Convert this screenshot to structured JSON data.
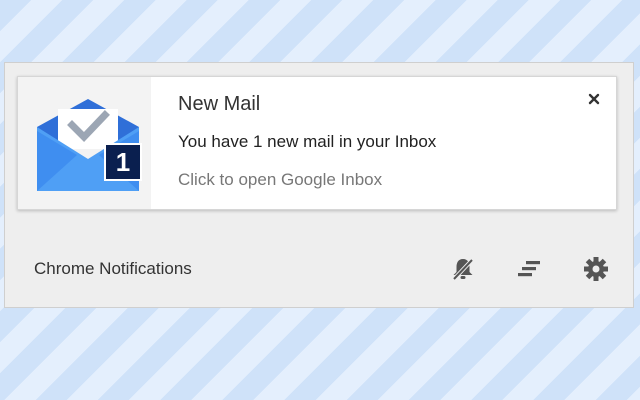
{
  "notification": {
    "title": "New Mail",
    "message": "You have 1 new mail in your Inbox",
    "context": "Click to open Google Inbox",
    "badge_count": "1",
    "app_icon": "google-inbox-icon",
    "close_icon": "close-icon"
  },
  "footer": {
    "title": "Chrome Notifications",
    "icons": [
      "do-not-disturb-icon",
      "clear-all-icon",
      "settings-gear-icon"
    ]
  },
  "colors": {
    "envelope_light": "#4f9ff5",
    "envelope_dark": "#2f6fd8",
    "badge_background": "#0a1f4f",
    "footer_icon": "#555555"
  }
}
